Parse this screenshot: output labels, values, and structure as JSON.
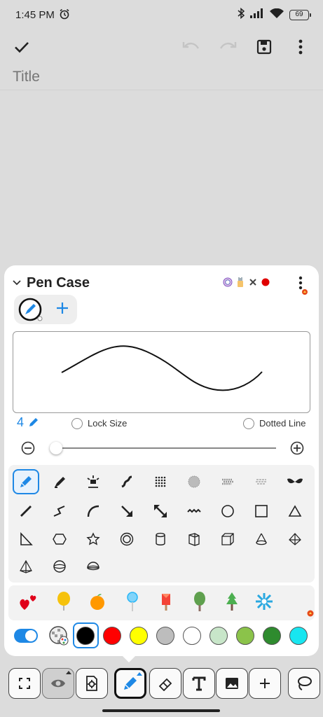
{
  "status": {
    "time": "1:45 PM",
    "battery": "69"
  },
  "title_field": {
    "placeholder": "Title",
    "value": ""
  },
  "panel": {
    "label": "Pen Case",
    "size_value": "4",
    "lock_size_label": "Lock Size",
    "dotted_line_label": "Dotted Line",
    "size_slider_level": 0.02
  },
  "tools": {
    "row1": [
      "pen-icon",
      "marker-icon",
      "sparkle-brush-icon",
      "squiggle-brush-icon",
      "dot-grid-brush-icon",
      "spray-icon",
      "charcoal-icon",
      "crayon-icon",
      "bow-brush-icon"
    ],
    "row2": [
      "line-icon",
      "zigzag-line-icon",
      "arc-icon",
      "arrow-icon",
      "double-arrow-icon",
      "wave-line-icon",
      "circle-icon",
      "square-icon",
      "triangle-icon"
    ],
    "row3": [
      "right-triangle-icon",
      "hexagon-icon",
      "star-icon",
      "ring-icon",
      "cylinder-icon",
      "prism-icon",
      "cube-icon",
      "cone-icon",
      "pyramid-icon"
    ],
    "row4": [
      "tetrahedron-icon",
      "sphere-icon",
      "hemisphere-icon"
    ]
  },
  "stickers": [
    "hearts-sticker",
    "balloon-sticker",
    "orange-sticker",
    "lollipop-sticker",
    "popsicle-sticker",
    "tree-sticker",
    "pine-tree-sticker",
    "flower-sticker"
  ],
  "colors": [
    "#000000",
    "#ff0000",
    "#ffff00",
    "#bdbdbd",
    "#ffffff",
    "#c8e6c9",
    "#8bc34a",
    "#2e8b2e",
    "#18e6f0"
  ],
  "accent": "#1e88e5"
}
